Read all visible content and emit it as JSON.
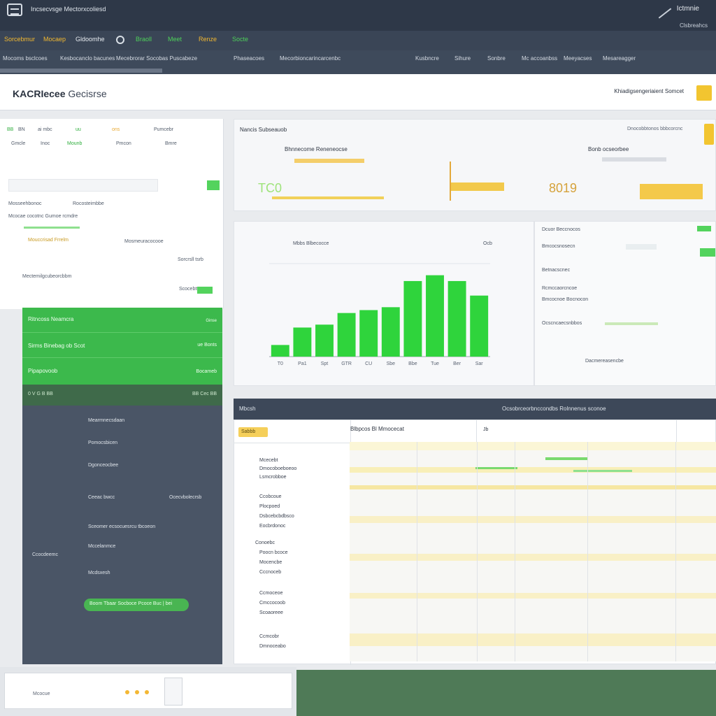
{
  "topbar": {
    "title": "Incsecvsge Mectorxcoliesd",
    "user": "Ictmnie",
    "user_sub": "Clsbreahcs"
  },
  "menu": [
    {
      "label": "Sorcebmur",
      "color": "#f2b830"
    },
    {
      "label": "Mocaep",
      "color": "#f2b830"
    },
    {
      "label": "Gldoomhe",
      "color": "#e9edf2"
    },
    {
      "label": "Braoll",
      "color": "#4ed15a"
    },
    {
      "label": "Meet",
      "color": "#4ed15a"
    },
    {
      "label": "Renze",
      "color": "#f2b830"
    },
    {
      "label": "Socte",
      "color": "#4ed15a"
    }
  ],
  "nav": {
    "left_items": [
      "Mocoms bsclcoes",
      "Kesbocanclo bacunes",
      "Mecebrorar Socobas Puscabeze",
      "Phaseacoes",
      "Mecorbioncarincarcenbc"
    ],
    "right_items": [
      "Kusbncre",
      "Sihure",
      "Sonbre",
      "Mc accoanbss",
      "Meeyacses",
      "Mesareagger"
    ]
  },
  "header": {
    "brand": "KACRIecee",
    "brand_sub": "Gecisrse",
    "right_text": "Khiadigsengeriaient Somcet"
  },
  "left": {
    "r1": [
      "BB",
      "BN",
      "ai mbc",
      "uu",
      "ons",
      "Pumcebr"
    ],
    "r2": [
      "Gmcle",
      "Inoc",
      "Mounb",
      "Pmcon",
      "Bmre"
    ],
    "line_a": "Mosseehbonoc",
    "line_b": "Rocosteimbbe",
    "line_c": "Mcocae cocotnc Gumoe rcmdre",
    "line_d": "Mouccrisad Frrelm",
    "line_e": "Mosmeuracocooe",
    "line_f": "Sorcrsll tsrb",
    "line_g": "Mectemilgcubeorcbbm",
    "line_h": "Scocebtt"
  },
  "greenpanel": [
    "Ritncoss Neamcra",
    "Sirms Binebag ob Scot",
    "Pipapovoob"
  ],
  "greenpanel_right": [
    "Ginse",
    "ue Bonts",
    "Bocameb"
  ],
  "darkpanel": {
    "filter_row": "0   V   G   B   BB",
    "filter_right": "BB   Cec   BB",
    "items": [
      "Mearmnecsdaan",
      "Pomocsbicen",
      "Dgonceocbee",
      "Ceeac bwcc",
      "Ocecvbolecrsb",
      "Rfocmcheo",
      "Sceomer ecsocuesrcu tbcoeon",
      "Mccelanmce",
      "Ccocdeemc",
      "Mcdsxesh"
    ],
    "chip": "Boom Tbaar Socboce Pcoce Buc | bei"
  },
  "kpi": {
    "title": "Nancis Subseauob",
    "right_hint": "Dnocobbtonos bbbcorcnc",
    "card1_title": "Bhnnecome Reneneocse",
    "card1_value": "TC0",
    "card2_title": "Bonb ocseorbee",
    "card2_value": "8019"
  },
  "chart_data": {
    "type": "bar",
    "title": "Mbbs Blbecocce",
    "categories": [
      "T0",
      "Pa1",
      "Spt",
      "GTR",
      "CU",
      "Sbe",
      "Bbe",
      "Tue",
      "Ber",
      "Sar"
    ],
    "values": [
      2,
      5,
      5.5,
      7.5,
      8,
      8.5,
      13,
      14,
      13,
      10.5
    ],
    "ylim": [
      0,
      16
    ],
    "accent": "#2fd43c",
    "annotation": "Ocb"
  },
  "side": {
    "title": "Dcuor Beccnocos",
    "rows": [
      "Bmcocsnosecn",
      "Betnacscnec",
      "Rcmccaorcncoe",
      "Bmcocnoe Bocnocon",
      "Ocscncaecsnbbos"
    ],
    "footer": "Dacmereasencbe"
  },
  "table": {
    "head_left": "Mbcsh",
    "head_right": "Ocsobrceorbnccondbs Rolnnenus sconoe",
    "subhead_btn": "Sabbb",
    "col1": "Blbpcos Bl Mmocecat",
    "col2": "Jb",
    "rows": [
      "Mcecebt",
      "Dmocoboeboeoo",
      "Lsmcrobboe",
      "Ccobcoue",
      "Plocpoed",
      "Dsbcebcbdbsco",
      "Eocbrdonoc",
      "Conoebc",
      "Poocn bcoce",
      "Mocencbe",
      "Cccnoceb",
      "Ccmoceoe",
      "Cmccocoob",
      "Scoaoreee",
      "Ccmcobr",
      "Dmnoceabo"
    ]
  },
  "bottom": {
    "label": "Mcocue"
  }
}
